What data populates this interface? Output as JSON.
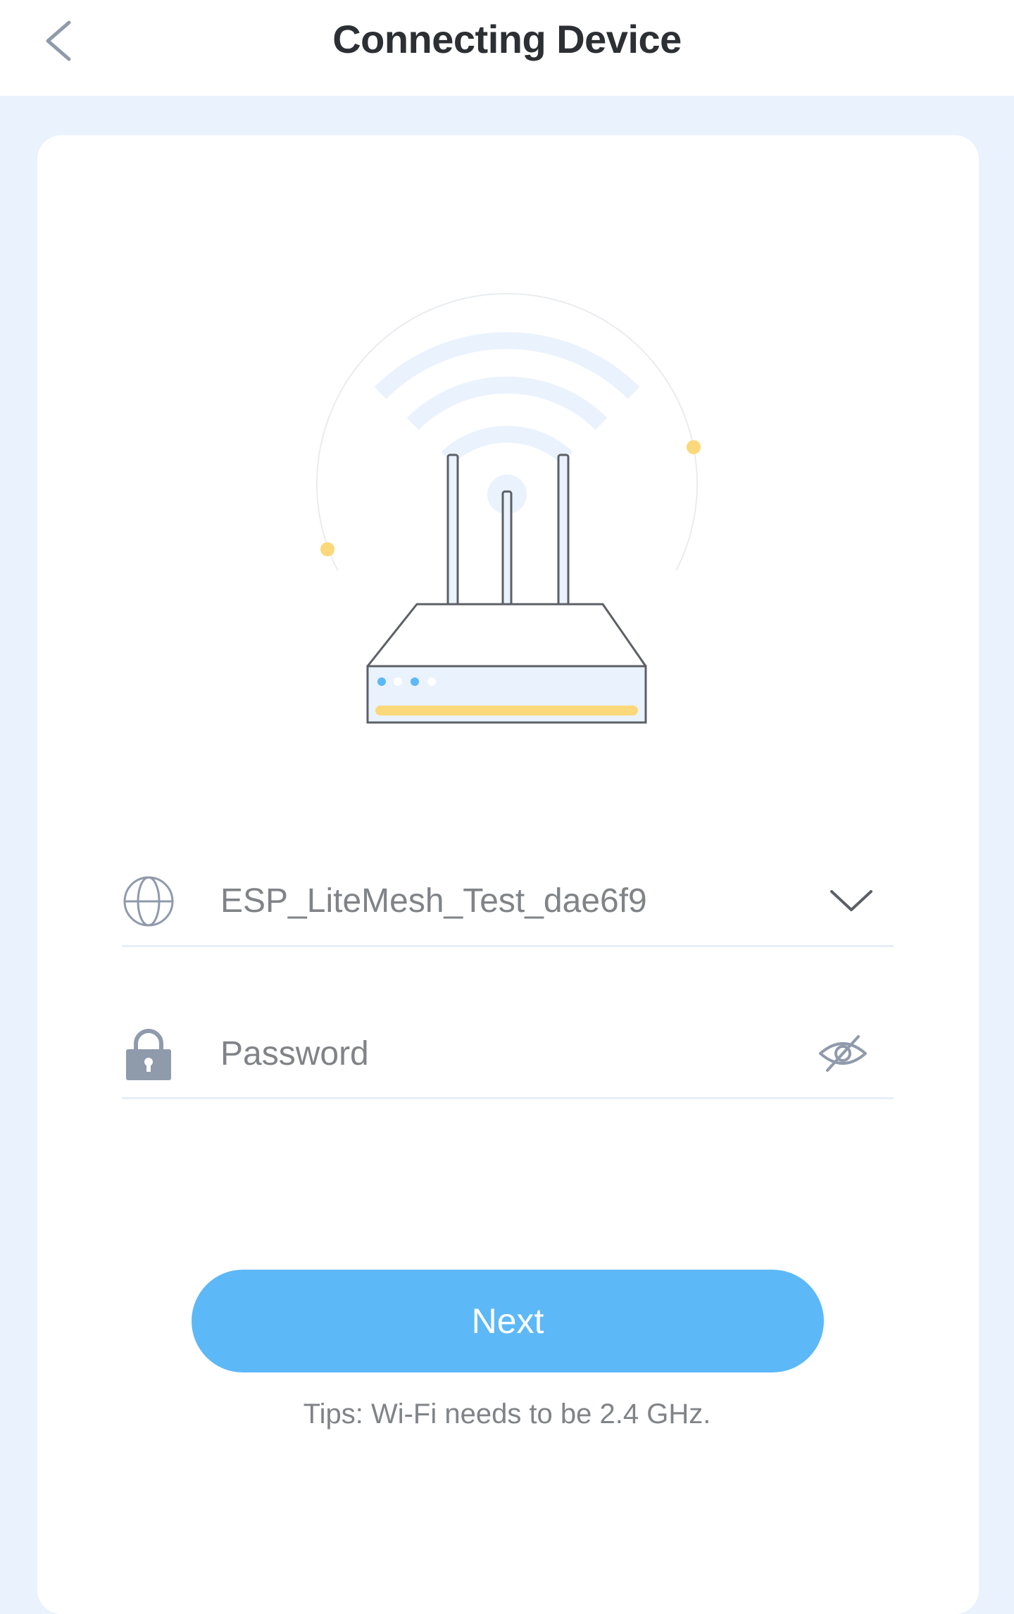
{
  "header": {
    "title": "Connecting Device",
    "back_icon": "chevron-left-icon"
  },
  "wifi_form": {
    "ssid": {
      "icon": "globe-icon",
      "value": "ESP_LiteMesh_Test_dae6f9",
      "dropdown_icon": "chevron-down-icon"
    },
    "password": {
      "icon": "lock-icon",
      "placeholder": "Password",
      "value": "",
      "visibility_icon": "eye-off-icon"
    }
  },
  "actions": {
    "next_label": "Next"
  },
  "tips": "Tips: Wi-Fi needs to be 2.4 GHz.",
  "colors": {
    "page_background": "#eaf2fd",
    "card": "#ffffff",
    "accent": "#5db8f7",
    "highlight_yellow": "#fbd879",
    "text_primary": "#2c2f33",
    "text_secondary": "#808387",
    "icon_gray": "#8f9aab"
  }
}
